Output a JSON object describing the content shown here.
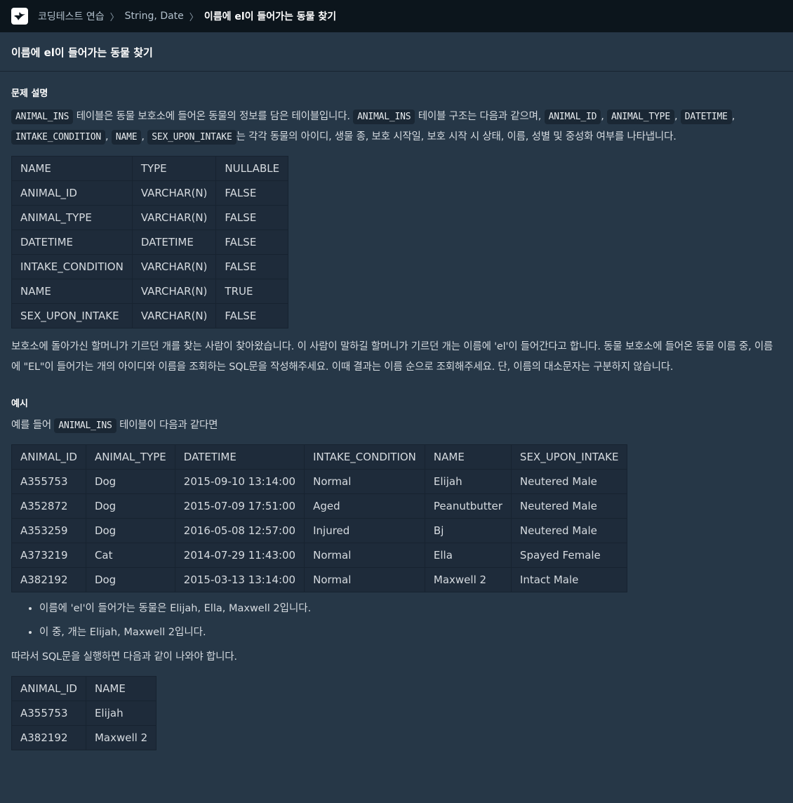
{
  "breadcrumb": {
    "items": [
      "코딩테스트 연습",
      "String, Date",
      "이름에 el이 들어가는 동물 찾기"
    ]
  },
  "page_title": "이름에 el이 들어가는 동물 찾기",
  "section_problem": "문제 설명",
  "intro": {
    "code_animal_ins": "ANIMAL_INS",
    "t1": " 테이블은 동물 보호소에 들어온 동물의 정보를 담은 테이블입니다. ",
    "t2": " 테이블 구조는 다음과 같으며, ",
    "code_animal_id": "ANIMAL_ID",
    "comma": ", ",
    "code_animal_type": "ANIMAL_TYPE",
    "code_datetime": "DATETIME",
    "code_intake_condition": "INTAKE_CONDITION",
    "code_name": "NAME",
    "code_sex_upon_intake": "SEX_UPON_INTAKE",
    "t3": "는 각각 동물의 아이디, 생물 종, 보호 시작일, 보호 시작 시 상태, 이름, 성별 및 중성화 여부를 나타냅니다."
  },
  "schema_table": {
    "headers": [
      "NAME",
      "TYPE",
      "NULLABLE"
    ],
    "rows": [
      [
        "ANIMAL_ID",
        "VARCHAR(N)",
        "FALSE"
      ],
      [
        "ANIMAL_TYPE",
        "VARCHAR(N)",
        "FALSE"
      ],
      [
        "DATETIME",
        "DATETIME",
        "FALSE"
      ],
      [
        "INTAKE_CONDITION",
        "VARCHAR(N)",
        "FALSE"
      ],
      [
        "NAME",
        "VARCHAR(N)",
        "TRUE"
      ],
      [
        "SEX_UPON_INTAKE",
        "VARCHAR(N)",
        "FALSE"
      ]
    ]
  },
  "problem_text": "보호소에 돌아가신 할머니가 기르던 개를 찾는 사람이 찾아왔습니다. 이 사람이 말하길 할머니가 기르던 개는 이름에 'el'이 들어간다고 합니다. 동물 보호소에 들어온 동물 이름 중, 이름에 \"EL\"이 들어가는 개의 아이디와 이름을 조회하는 SQL문을 작성해주세요. 이때 결과는 이름 순으로 조회해주세요. 단, 이름의 대소문자는 구분하지 않습니다.",
  "section_example": "예시",
  "example_intro": {
    "t1": "예를 들어 ",
    "code": "ANIMAL_INS",
    "t2": " 테이블이 다음과 같다면"
  },
  "example_table": {
    "headers": [
      "ANIMAL_ID",
      "ANIMAL_TYPE",
      "DATETIME",
      "INTAKE_CONDITION",
      "NAME",
      "SEX_UPON_INTAKE"
    ],
    "rows": [
      [
        "A355753",
        "Dog",
        "2015-09-10 13:14:00",
        "Normal",
        "Elijah",
        "Neutered Male"
      ],
      [
        "A352872",
        "Dog",
        "2015-07-09 17:51:00",
        "Aged",
        "Peanutbutter",
        "Neutered Male"
      ],
      [
        "A353259",
        "Dog",
        "2016-05-08 12:57:00",
        "Injured",
        "Bj",
        "Neutered Male"
      ],
      [
        "A373219",
        "Cat",
        "2014-07-29 11:43:00",
        "Normal",
        "Ella",
        "Spayed Female"
      ],
      [
        "A382192",
        "Dog",
        "2015-03-13 13:14:00",
        "Normal",
        "Maxwell 2",
        "Intact Male"
      ]
    ]
  },
  "bullets": [
    "이름에 'el'이 들어가는 동물은 Elijah, Ella, Maxwell 2입니다.",
    "이 중, 개는 Elijah, Maxwell 2입니다."
  ],
  "result_intro": "따라서 SQL문을 실행하면 다음과 같이 나와야 합니다.",
  "result_table": {
    "headers": [
      "ANIMAL_ID",
      "NAME"
    ],
    "rows": [
      [
        "A355753",
        "Elijah"
      ],
      [
        "A382192",
        "Maxwell 2"
      ]
    ]
  }
}
